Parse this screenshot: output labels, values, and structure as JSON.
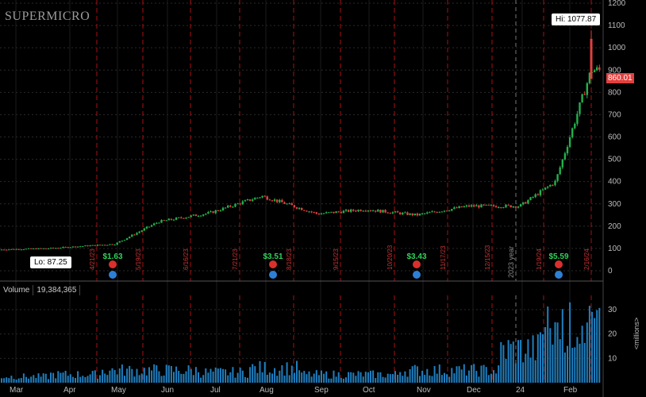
{
  "brand": {
    "logo_text": "SUPERMICRO"
  },
  "price_panel": {
    "hi_label": "Hi: 1077.87",
    "lo_label": "Lo: 87.25",
    "last_price_label": "860.01",
    "year_marker": "2023 year",
    "y_ticks": [
      "1200",
      "1100",
      "1000",
      "900",
      "800",
      "700",
      "600",
      "500",
      "400",
      "300",
      "200",
      "100",
      "0"
    ]
  },
  "volume_panel": {
    "label": "Volume",
    "value": "19,384,365",
    "unit_label": "<millions>",
    "y_ticks": [
      "30",
      "20",
      "10"
    ]
  },
  "x_axis": {
    "months": [
      "Mar",
      "Apr",
      "May",
      "Jun",
      "Jul",
      "Aug",
      "Sep",
      "Oct",
      "Nov",
      "Dec",
      "24",
      "Feb"
    ]
  },
  "events": {
    "dividend_labels": [
      "$1.63",
      "$3.51",
      "$3.43",
      "$5.59"
    ],
    "date_lines": [
      "4/21/23",
      "5/19/23",
      "6/16/23",
      "7/21/23",
      "8/18/23",
      "9/15/23",
      "10/20/23",
      "11/17/23",
      "12/15/23",
      "1/19/24",
      "2/16/24"
    ]
  },
  "colors": {
    "up": "#22b14c",
    "down": "#e0403e",
    "grid": "#2a2a2a",
    "event_line": "#a11",
    "volume": "#1f7fc0"
  },
  "chart_data": {
    "type": "candlestick",
    "price_range": [
      0,
      1200
    ],
    "volume_range": [
      0,
      35
    ],
    "price_series": {
      "x": [
        "2023-03",
        "2023-04",
        "2023-05",
        "2023-06",
        "2023-07",
        "2023-08",
        "2023-09",
        "2023-10",
        "2023-11",
        "2023-12",
        "2024-01",
        "2024-02"
      ],
      "close": [
        95,
        110,
        165,
        260,
        300,
        285,
        260,
        270,
        280,
        290,
        340,
        860
      ]
    },
    "volume_millions": [
      3,
      4,
      6,
      6,
      5,
      7,
      4,
      4,
      6,
      6,
      16,
      24
    ]
  }
}
